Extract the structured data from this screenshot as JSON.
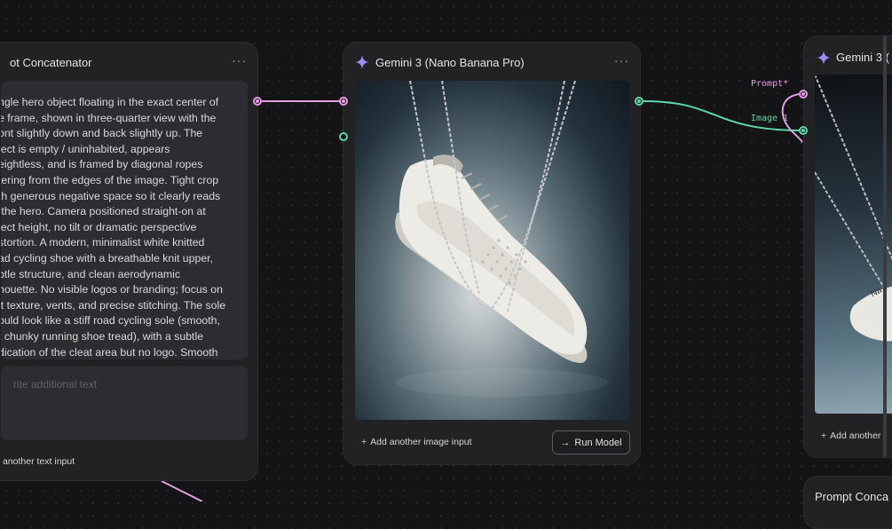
{
  "nodes": {
    "concat": {
      "title": "ot Concatenator",
      "menu": "···",
      "prompt_text": "ngle hero object floating in the exact center of\ne frame, shown in three-quarter view with the\nont slightly down and back slightly up. The\nject is empty / uninhabited, appears\neightless, and is framed by diagonal ropes\ntering from the edges of the image. Tight crop\nth generous negative space so it clearly reads\n the hero. Camera positioned straight-on at\nject height, no tilt or dramatic perspective\nstortion. A modern, minimalist white knitted\nad cycling shoe with a breathable knit upper,\nbtle structure, and clean aerodynamic\nhouette. No visible logos or branding; focus on\nit texture, vents, and precise stitching. The sole\nould look like a stiff road cycling sole (smooth,\nt chunky running shoe tread), with a subtle\ndication of the cleat area but no logo. Smooth",
      "placeholder": "rite additional text",
      "add_input": "another text input"
    },
    "gemini_main": {
      "title": "Gemini 3 (Nano Banana Pro)",
      "menu": "···",
      "add_image_input": "Add another image input",
      "run_label": "Run Model"
    },
    "gemini_right": {
      "title": "Gemini 3 (",
      "add_input": "Add another i",
      "shoe_text": "Na"
    },
    "concat_bottom": {
      "title": "Prompt Conca"
    }
  },
  "ports": {
    "prompt_label": "Prompt*",
    "image_label": "Image 1"
  },
  "colors": {
    "prompt_port": "#e59ce6",
    "image_port": "#5fd6a6",
    "sparkle": "#9d8cf5"
  },
  "icons": {
    "sparkle": "sparkle-icon",
    "plus": "plus-icon",
    "arrow": "arrow-right-icon"
  }
}
